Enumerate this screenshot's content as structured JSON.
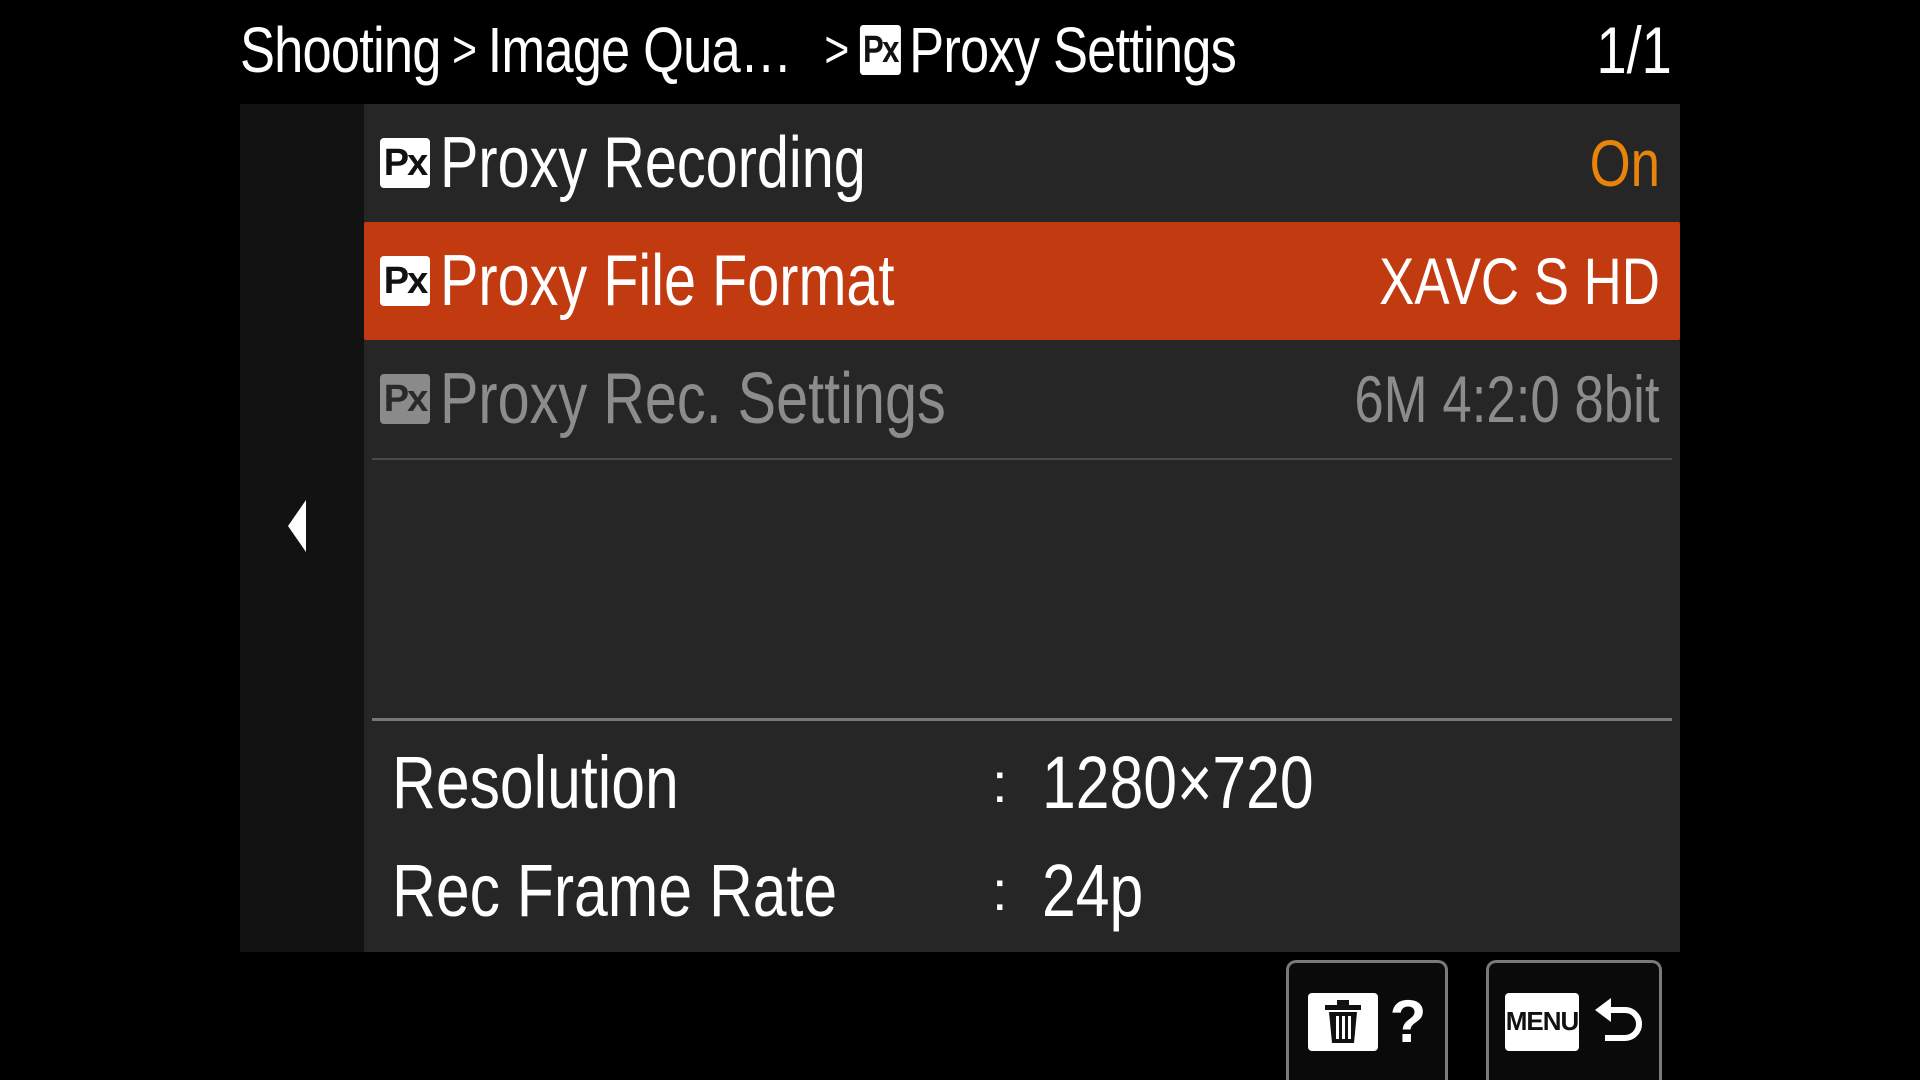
{
  "header": {
    "breadcrumb": [
      "Shooting",
      "Image Qua…",
      "Proxy Settings"
    ],
    "separator": ">",
    "page_indicator": "1/1"
  },
  "badge_text": "Px",
  "menu_items": [
    {
      "label": "Proxy Recording",
      "value": "On",
      "state": "normal"
    },
    {
      "label": "Proxy File Format",
      "value": "XAVC S HD",
      "state": "selected"
    },
    {
      "label": "Proxy Rec. Settings",
      "value": "6M 4:2:0 8bit",
      "state": "disabled"
    }
  ],
  "info": {
    "resolution_label": "Resolution",
    "resolution_value": "1280×720",
    "frame_rate_label": "Rec Frame Rate",
    "frame_rate_value": "24p",
    "separator": ":"
  },
  "buttons": {
    "delete_help_symbol": "?",
    "menu_label": "MENU"
  },
  "colors": {
    "selected_row": "#c13a10",
    "value_on": "#e8840c",
    "disabled_text": "#8c8c8c"
  },
  "icons": {
    "back_arrow": "left-arrow-icon",
    "delete": "trash-icon",
    "return": "return-arrow-icon"
  }
}
